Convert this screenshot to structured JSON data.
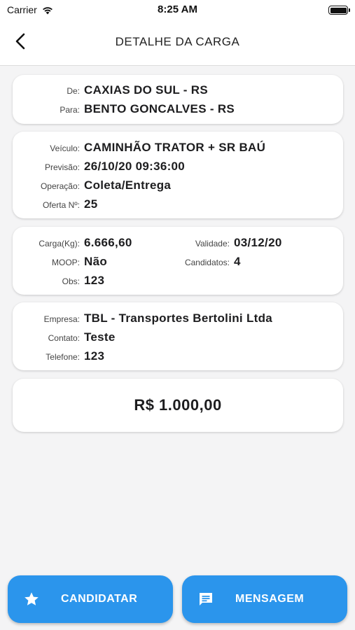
{
  "status_bar": {
    "carrier": "Carrier",
    "time": "8:25 AM"
  },
  "header": {
    "title": "DETALHE DA CARGA",
    "back_icon": "chevron-left-icon"
  },
  "route_card": {
    "from_label": "De:",
    "from_value": "CAXIAS DO SUL - RS",
    "to_label": "Para:",
    "to_value": "BENTO GONCALVES - RS"
  },
  "vehicle_card": {
    "vehicle_label": "Veículo:",
    "vehicle_value": "CAMINHÃO TRATOR + SR BAÚ",
    "forecast_label": "Previsão:",
    "forecast_value": "26/10/20 09:36:00",
    "operation_label": "Operação:",
    "operation_value": "Coleta/Entrega",
    "offer_label": "Oferta Nº:",
    "offer_value": "25"
  },
  "cargo_card": {
    "weight_label": "Carga(Kg):",
    "weight_value": "6.666,60",
    "validity_label": "Validade:",
    "validity_value": "03/12/20",
    "moop_label": "MOOP:",
    "moop_value": "Não",
    "candidates_label": "Candidatos:",
    "candidates_value": "4",
    "obs_label": "Obs:",
    "obs_value": "123"
  },
  "company_card": {
    "company_label": "Empresa:",
    "company_value": "TBL - Transportes Bertolini Ltda",
    "contact_label": "Contato:",
    "contact_value": "Teste",
    "phone_label": "Telefone:",
    "phone_value": "123"
  },
  "price_card": {
    "price": "R$ 1.000,00"
  },
  "actions": {
    "apply_label": "CANDIDATAR",
    "apply_icon": "star-icon",
    "message_label": "MENSAGEM",
    "message_icon": "chat-icon"
  },
  "colors": {
    "accent": "#2b95ec",
    "background": "#f4f4f5",
    "card": "#ffffff"
  }
}
